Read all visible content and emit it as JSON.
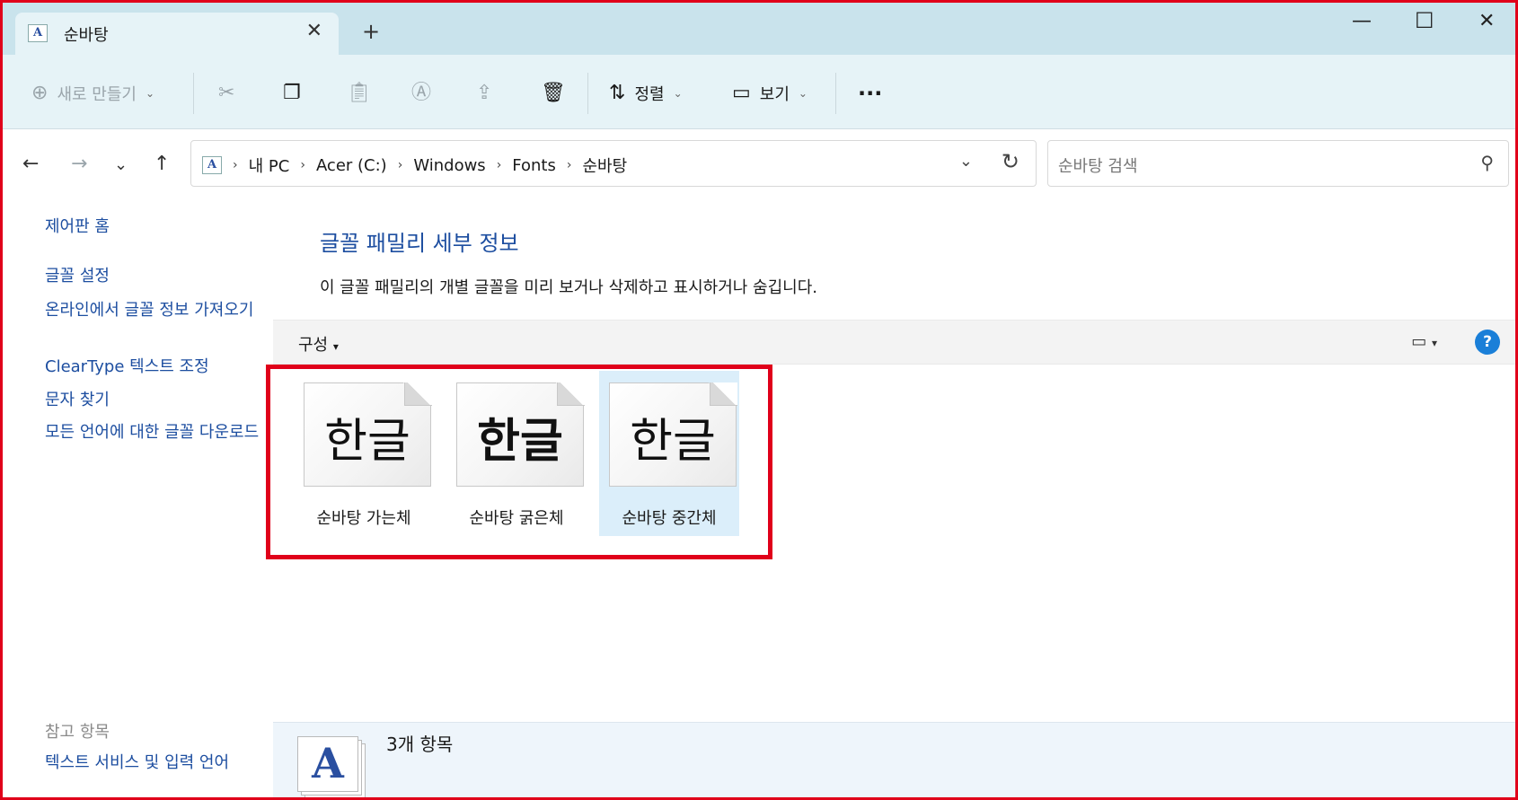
{
  "window": {
    "tab_title": "순바탕",
    "tab_icon": "font-folder-icon"
  },
  "toolbar": {
    "new_label": "새로 만들기",
    "sort_label": "정렬",
    "view_label": "보기"
  },
  "address": {
    "crumbs": [
      "내 PC",
      "Acer (C:)",
      "Windows",
      "Fonts",
      "순바탕"
    ],
    "search_placeholder": "순바탕 검색"
  },
  "left_pane": {
    "links": [
      "제어판 홈",
      "글꼴 설정",
      "온라인에서 글꼴 정보 가져오기",
      "ClearType 텍스트 조정",
      "문자 찾기",
      "모든 언어에 대한 글꼴 다운로드"
    ],
    "see_also_heading": "참고 항목",
    "see_also_link": "텍스트 서비스 및 입력 언어"
  },
  "main": {
    "title": "글꼴 패밀리 세부 정보",
    "description": "이 글꼴 패밀리의 개별 글꼴을 미리 보거나 삭제하고 표시하거나 숨깁니다.",
    "organize_label": "구성",
    "fonts": [
      {
        "label": "순바탕 가는체",
        "preview": "한글",
        "selected": false
      },
      {
        "label": "순바탕 굵은체",
        "preview": "한글",
        "selected": false
      },
      {
        "label": "순바탕 중간체",
        "preview": "한글",
        "selected": true
      }
    ],
    "details_count": "3개 항목",
    "details_glyph": "A"
  },
  "colors": {
    "accent_link": "#1d4ea0",
    "highlight_border": "#e0001a",
    "selection": "#dbeefa"
  }
}
